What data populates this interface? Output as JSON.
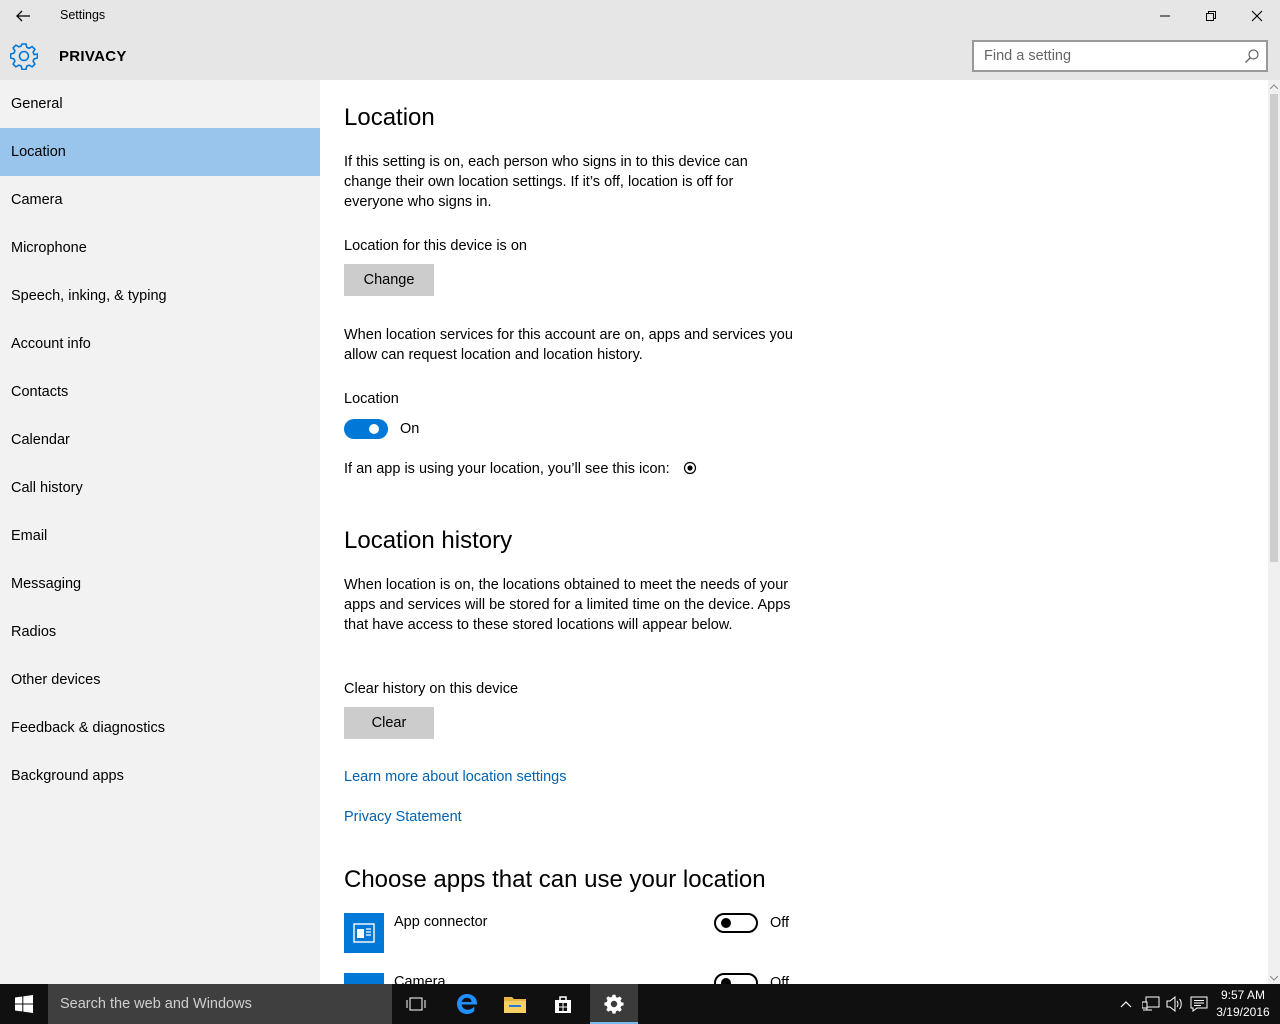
{
  "window": {
    "title": "Settings",
    "back_icon": "back-arrow-icon",
    "minimize_icon": "minimize-icon",
    "restore_icon": "restore-icon",
    "close_icon": "close-icon"
  },
  "header": {
    "icon": "gear-icon",
    "title": "PRIVACY",
    "search_placeholder": "Find a setting"
  },
  "sidebar": {
    "items": [
      {
        "label": "General"
      },
      {
        "label": "Location",
        "selected": true
      },
      {
        "label": "Camera"
      },
      {
        "label": "Microphone"
      },
      {
        "label": "Speech, inking, & typing"
      },
      {
        "label": "Account info"
      },
      {
        "label": "Contacts"
      },
      {
        "label": "Calendar"
      },
      {
        "label": "Call history"
      },
      {
        "label": "Email"
      },
      {
        "label": "Messaging"
      },
      {
        "label": "Radios"
      },
      {
        "label": "Other devices"
      },
      {
        "label": "Feedback & diagnostics"
      },
      {
        "label": "Background apps"
      }
    ]
  },
  "main": {
    "location_heading": "Location",
    "location_desc": "If this setting is on, each person who signs in to this device can change their own location settings. If it’s off, location is off for everyone who signs in.",
    "device_status": "Location for this device is on",
    "change_button": "Change",
    "account_desc": "When location services for this account are on, apps and services you allow can request location and location history.",
    "location_toggle_label": "Location",
    "location_toggle_state": "On",
    "icon_hint": "If an app is using your location, you’ll see this icon:",
    "history_heading": "Location history",
    "history_desc": "When location is on, the locations obtained to meet the needs of your apps and services will be stored for a limited time on the device. Apps that have access to these stored locations will appear below.",
    "clear_label": "Clear history on this device",
    "clear_button": "Clear",
    "learn_more_link": "Learn more about location settings",
    "privacy_link": "Privacy Statement",
    "apps_heading": "Choose apps that can use your location",
    "apps": [
      {
        "name": "App connector",
        "state": "Off",
        "icon": "app-connector-icon"
      },
      {
        "name": "Camera",
        "state": "Off",
        "icon": "camera-app-icon"
      }
    ]
  },
  "taskbar": {
    "search_text": "Search the web and Windows",
    "time": "9:57 AM",
    "date": "3/19/2016"
  },
  "colors": {
    "accent": "#0078d7",
    "selected_nav": "#99c4ec",
    "link": "#0063b1",
    "chrome": "#e6e6e6",
    "sidebar_bg": "#f2f2f2"
  }
}
